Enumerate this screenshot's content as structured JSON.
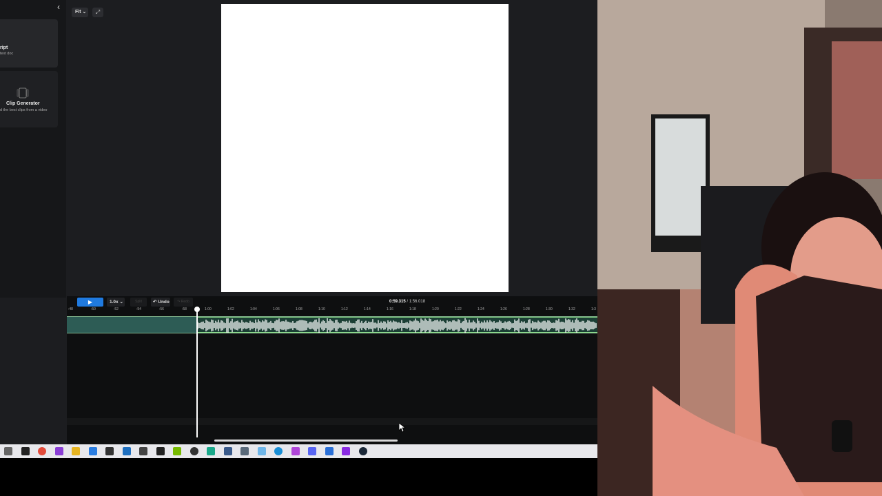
{
  "sidebar": {
    "collapse_icon": "chevron-left-icon",
    "cards": [
      {
        "title": "ript",
        "subtitle": "text doc",
        "icon": "script-icon"
      },
      {
        "title": "Clip Generator",
        "subtitle": "d the best clips from a video",
        "icon": "clip-generator-icon"
      }
    ]
  },
  "canvas_toolbar": {
    "fit_label": "Fit",
    "ratio_icon": "aspect-ratio-icon"
  },
  "timeline": {
    "play_icon": "play-icon",
    "speed_label": "1.0x",
    "undo_label": "↶ Undo",
    "split_label": "Split",
    "redo_label": "↷ Redo",
    "current_time": "0:59.315",
    "total_time": "/ 1:56.018",
    "ruler_ticks": [
      ":48",
      ":50",
      ":52",
      ":54",
      ":56",
      ":58",
      "1:00",
      "1:02",
      "1:04",
      "1:06",
      "1:08",
      "1:10",
      "1:12",
      "1:14",
      "1:16",
      "1:18",
      "1:20",
      "1:22",
      "1:24",
      "1:26",
      "1:28",
      "1:30",
      "1:32",
      "1:3"
    ]
  },
  "taskbar": {
    "icons": [
      "task-view-icon",
      "alienware-icon",
      "chrome-icon",
      "app-icon",
      "file-explorer-icon",
      "store-icon",
      "app-icon",
      "app-icon",
      "alien-icon",
      "terminal-icon",
      "nvidia-icon",
      "obs-icon",
      "active-app-icon",
      "app-icon",
      "app-icon",
      "app-icon",
      "edge-icon",
      "app-icon",
      "discord-icon",
      "app-icon",
      "app-icon",
      "steam-icon"
    ]
  },
  "colors": {
    "accent": "#1f7ae0",
    "track": "#2d5c55",
    "clip_border": "#8fe08c"
  }
}
